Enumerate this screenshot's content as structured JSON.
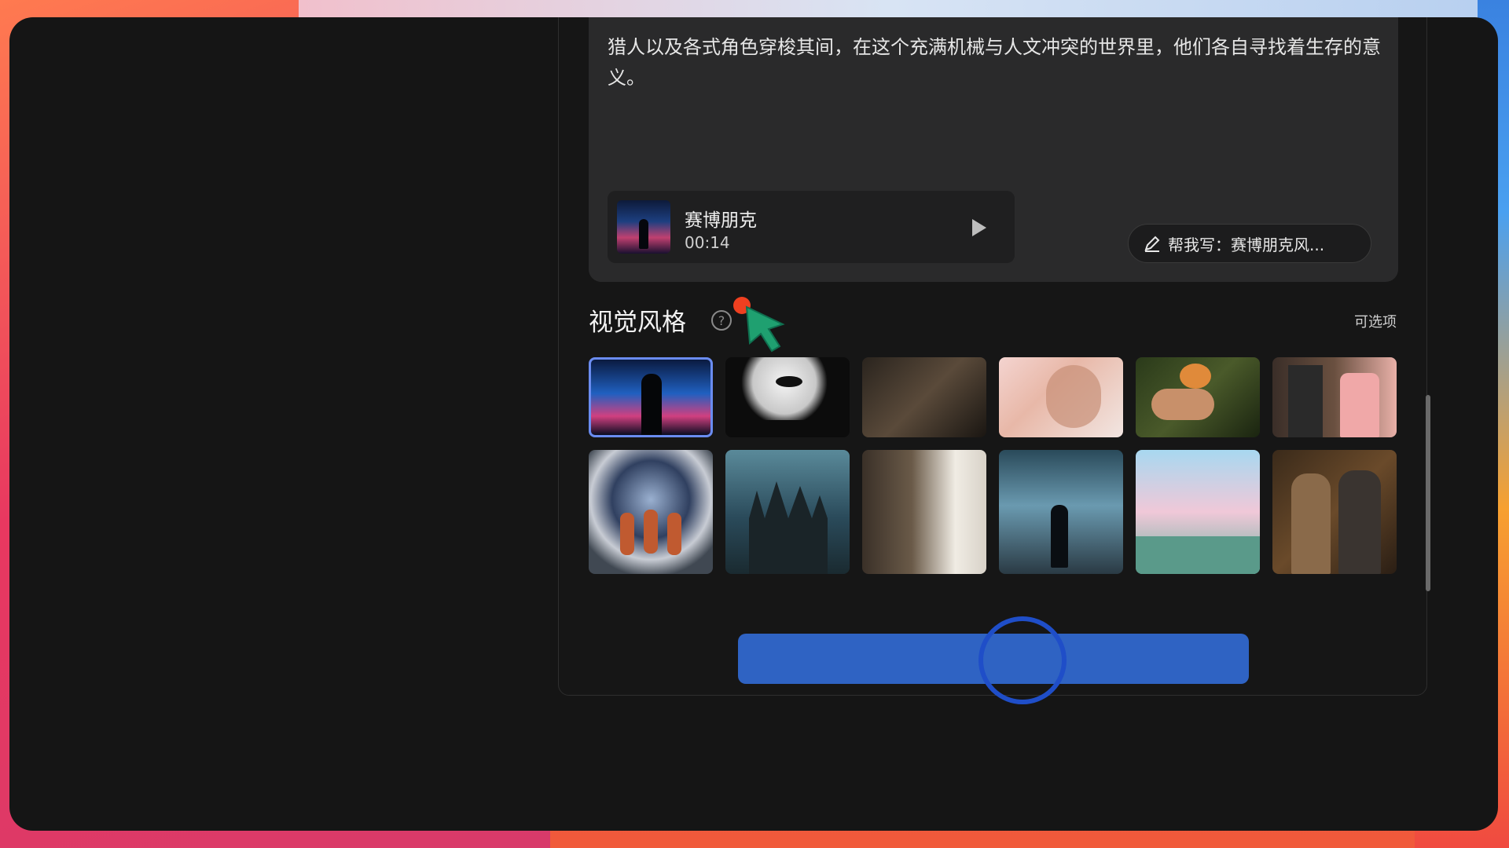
{
  "description": {
    "text": "猎人以及各式角色穿梭其间，在这个充满机械与人文冲突的世界里，他们各自寻找着生存的意义。"
  },
  "audio": {
    "title": "赛博朋克",
    "duration": "00:14",
    "thumb_icon": "cyberpunk-thumbnail",
    "play_icon": "play-icon"
  },
  "help_write": {
    "icon": "pen-icon",
    "label": "帮我写：赛博朋克风..."
  },
  "visual_style": {
    "title": "视觉风格",
    "help_icon": "?",
    "optional_label": "可选项",
    "selected_index": 0,
    "styles": [
      "cyberpunk-street",
      "moon-silhouette",
      "dark-cinematic",
      "dreamy-portrait",
      "peach-closeup",
      "wedding-couple",
      "astronauts-portal",
      "fantasy-castle",
      "sunlit-library",
      "floating-debris",
      "candy-pastel",
      "retro-couple"
    ]
  },
  "colors": {
    "accent": "#2f63c3",
    "selected_border": "#6a8cf0",
    "cursor": "#1fa070",
    "cursor_dot": "#f04020"
  }
}
